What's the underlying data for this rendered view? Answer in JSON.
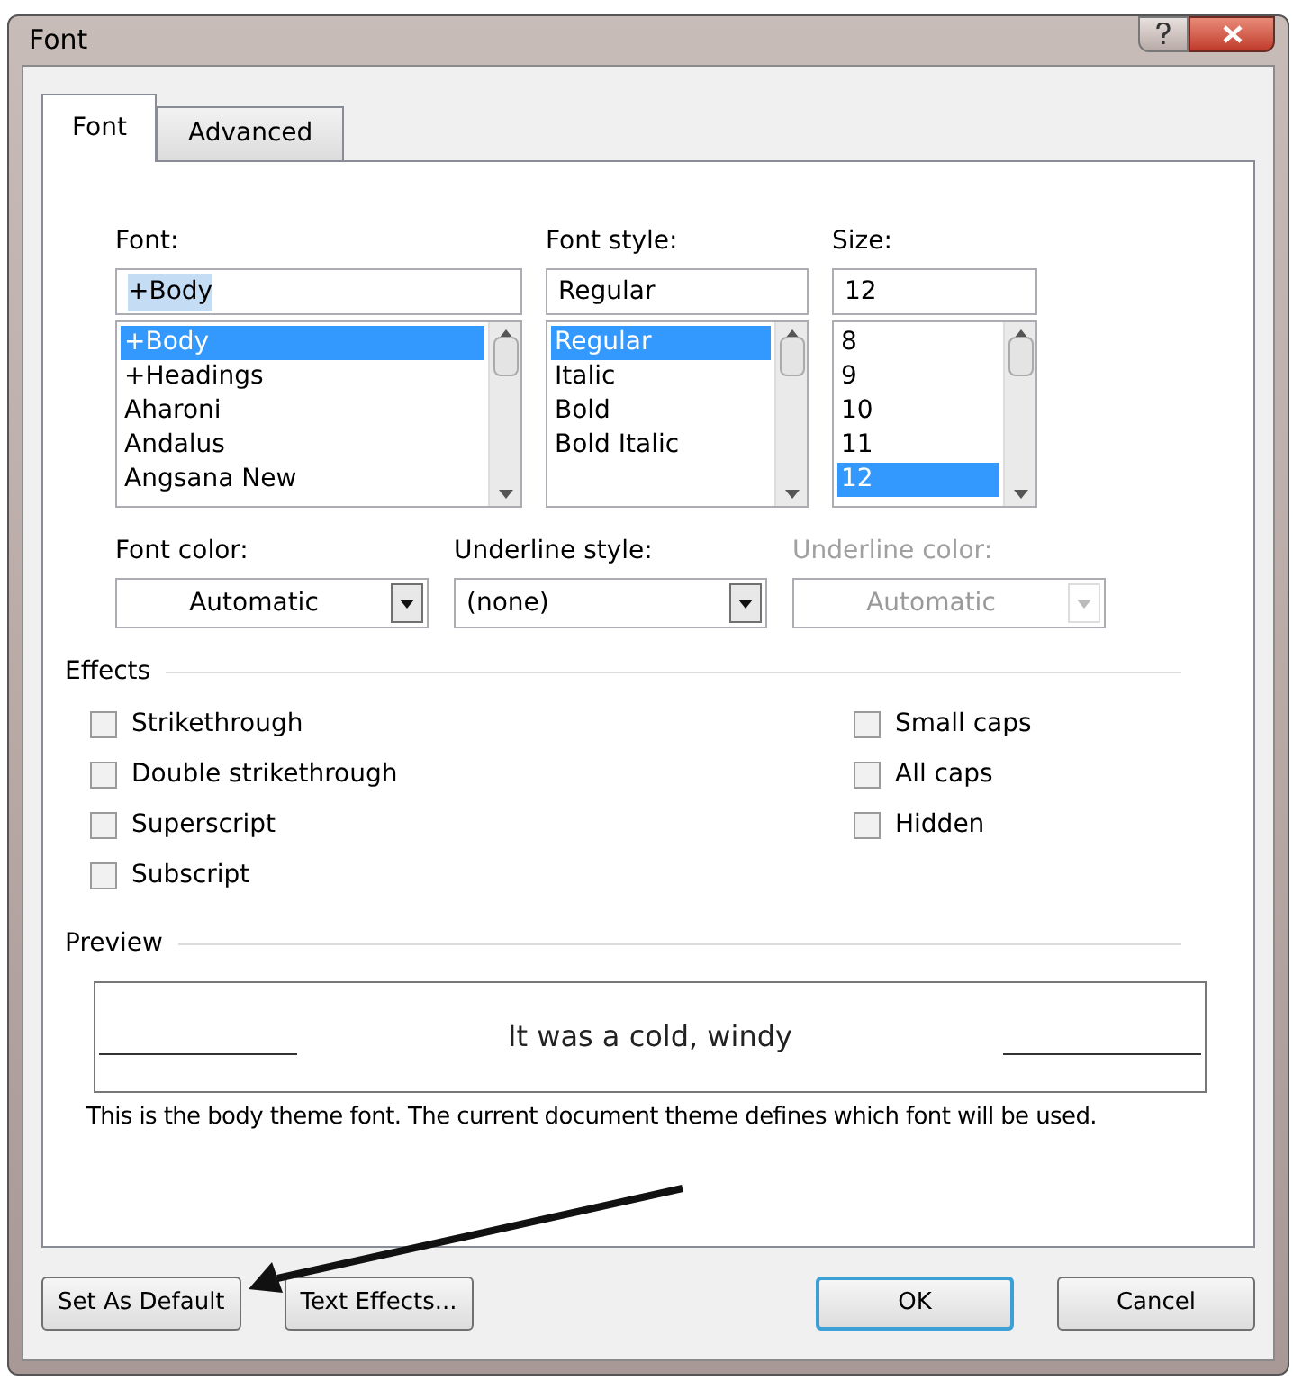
{
  "window": {
    "title": "Font"
  },
  "tabs": [
    {
      "label": "Font",
      "selected": true
    },
    {
      "label": "Advanced",
      "selected": false
    }
  ],
  "font": {
    "label": "Font:",
    "value": "+Body",
    "items": [
      {
        "label": "+Body",
        "selected": true
      },
      {
        "label": "+Headings",
        "selected": false
      },
      {
        "label": "Aharoni",
        "selected": false
      },
      {
        "label": "Andalus",
        "selected": false
      },
      {
        "label": "Angsana New",
        "selected": false
      }
    ]
  },
  "font_style": {
    "label": "Font style:",
    "value": "Regular",
    "items": [
      {
        "label": "Regular",
        "selected": true
      },
      {
        "label": "Italic",
        "selected": false
      },
      {
        "label": "Bold",
        "selected": false
      },
      {
        "label": "Bold Italic",
        "selected": false
      }
    ]
  },
  "size": {
    "label": "Size:",
    "value": "12",
    "items": [
      {
        "label": "8",
        "selected": false
      },
      {
        "label": "9",
        "selected": false
      },
      {
        "label": "10",
        "selected": false
      },
      {
        "label": "11",
        "selected": false
      },
      {
        "label": "12",
        "selected": true
      }
    ]
  },
  "combos": [
    {
      "label": "Font color:",
      "value": "Automatic",
      "disabled": false,
      "kind": "color"
    },
    {
      "label": "Underline style:",
      "value": "(none)",
      "disabled": false,
      "kind": "style"
    },
    {
      "label": "Underline color:",
      "value": "Automatic",
      "disabled": true,
      "kind": "color"
    }
  ],
  "effects": {
    "title": "Effects",
    "left": [
      {
        "label": "Strikethrough",
        "checked": false
      },
      {
        "label": "Double strikethrough",
        "checked": false
      },
      {
        "label": "Superscript",
        "checked": false
      },
      {
        "label": "Subscript",
        "checked": false
      }
    ],
    "right": [
      {
        "label": "Small caps",
        "checked": false
      },
      {
        "label": "All caps",
        "checked": false
      },
      {
        "label": "Hidden",
        "checked": false
      }
    ]
  },
  "preview": {
    "title": "Preview",
    "sample": "It was a cold, windy",
    "description": "This is the body theme font. The current document theme defines which font will be used."
  },
  "buttons": [
    {
      "label": "Set As Default",
      "default": false
    },
    {
      "label": "Text Effects...",
      "default": false
    },
    {
      "label": "OK",
      "default": true
    },
    {
      "label": "Cancel",
      "default": false
    }
  ]
}
